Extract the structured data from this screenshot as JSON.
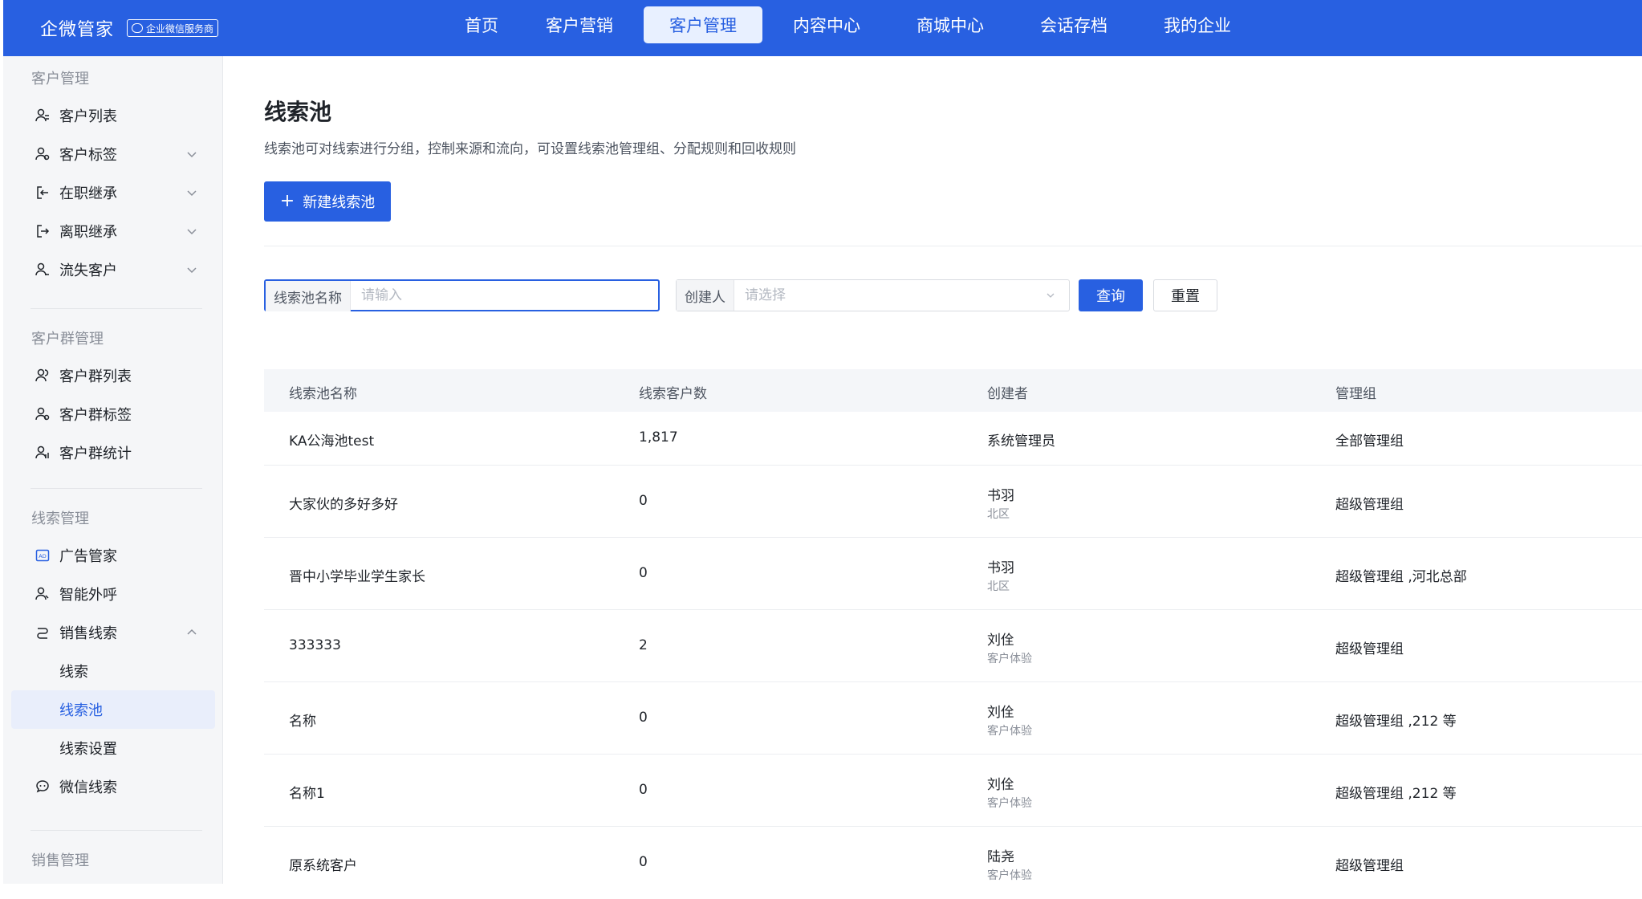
{
  "brand": {
    "name": "企微管家",
    "badge": "企业微信服务商"
  },
  "nav": [
    {
      "label": "首页"
    },
    {
      "label": "客户营销"
    },
    {
      "label": "客户管理"
    },
    {
      "label": "内容中心"
    },
    {
      "label": "商城中心"
    },
    {
      "label": "会话存档"
    },
    {
      "label": "我的企业"
    }
  ],
  "nav_active": "客户管理",
  "sidebar": {
    "groups": [
      "客户管理",
      "客户群管理",
      "线索管理",
      "销售管理"
    ],
    "items": [
      {
        "label": "客户列表",
        "icon": "user-list-icon"
      },
      {
        "label": "客户标签",
        "icon": "user-tag-icon"
      },
      {
        "label": "在职继承",
        "icon": "login-icon"
      },
      {
        "label": "离职继承",
        "icon": "logout-icon"
      },
      {
        "label": "流失客户",
        "icon": "user-lost-icon"
      },
      {
        "label": "客户群列表",
        "icon": "group-list-icon"
      },
      {
        "label": "客户群标签",
        "icon": "group-tag-icon"
      },
      {
        "label": "客户群统计",
        "icon": "group-stats-icon"
      },
      {
        "label": "广告管家",
        "icon": "ad-icon"
      },
      {
        "label": "智能外呼",
        "icon": "call-icon"
      },
      {
        "label": "销售线索",
        "icon": "lead-icon"
      },
      {
        "label": "线索"
      },
      {
        "label": "线索池"
      },
      {
        "label": "线索设置"
      },
      {
        "label": "微信线索",
        "icon": "wechat-icon"
      }
    ],
    "active": "线索池"
  },
  "page": {
    "title": "线索池",
    "description": "线索池可对线索进行分组，控制来源和流向，可设置线索池管理组、分配规则和回收规则",
    "new_button": "新建线索池"
  },
  "filters": {
    "name_label": "线索池名称",
    "name_placeholder": "请输入",
    "name_value": "",
    "creator_label": "创建人",
    "creator_placeholder": "请选择",
    "query_button": "查询",
    "reset_button": "重置"
  },
  "table": {
    "columns": [
      "线索池名称",
      "线索客户数",
      "创建者",
      "管理组"
    ],
    "rows": [
      {
        "name": "KA公海池test",
        "count": "1,817",
        "creator": "系统管理员",
        "creator_dept": "",
        "group": "全部管理组"
      },
      {
        "name": "大家伙的多好多好",
        "count": "0",
        "creator": "书羽",
        "creator_dept": "北区",
        "group": "超级管理组"
      },
      {
        "name": "晋中小学毕业学生家长",
        "count": "0",
        "creator": "书羽",
        "creator_dept": "北区",
        "group": "超级管理组 ,河北总部"
      },
      {
        "name": "333333",
        "count": "2",
        "creator": "刘佺",
        "creator_dept": "客户体验",
        "group": "超级管理组"
      },
      {
        "name": "名称",
        "count": "0",
        "creator": "刘佺",
        "creator_dept": "客户体验",
        "group": "超级管理组 ,212 等"
      },
      {
        "name": "名称1",
        "count": "0",
        "creator": "刘佺",
        "creator_dept": "客户体验",
        "group": "超级管理组 ,212 等"
      },
      {
        "name": "原系统客户",
        "count": "0",
        "creator": "陆尧",
        "creator_dept": "客户体验",
        "group": "超级管理组"
      }
    ]
  }
}
